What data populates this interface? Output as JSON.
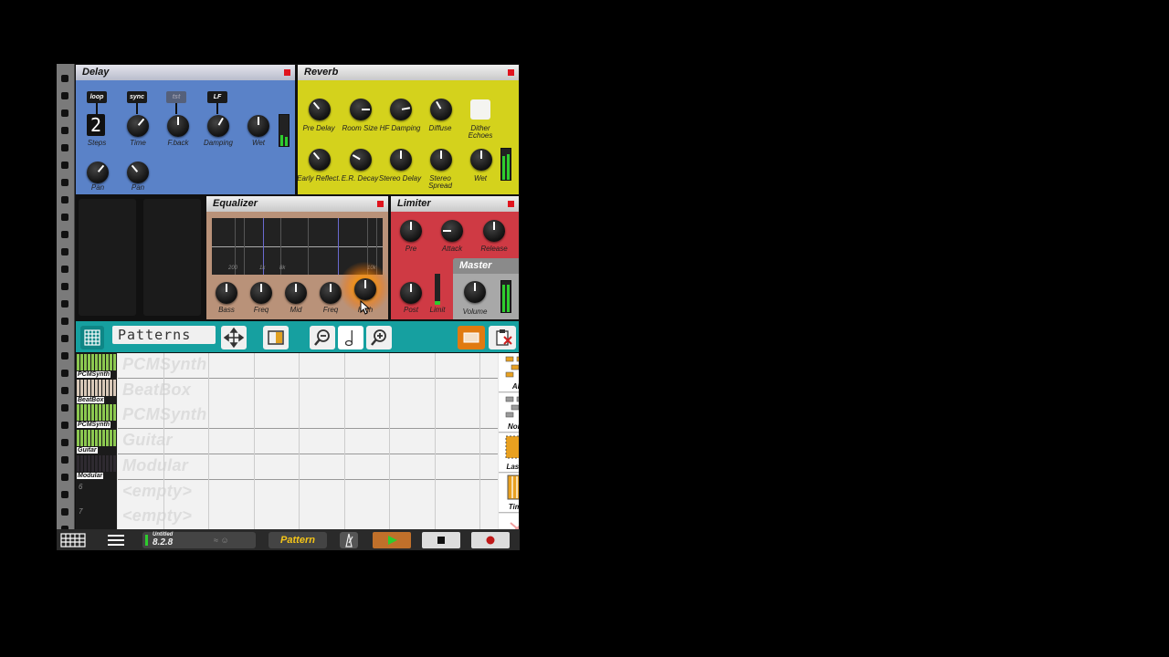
{
  "delay": {
    "title": "Delay",
    "toggles": [
      "loop",
      "sync",
      "tst",
      "LF"
    ],
    "steps_value": "2",
    "knobs": [
      "Steps",
      "Time",
      "F.back",
      "Damping",
      "Wet"
    ],
    "pan_knobs": [
      "Pan",
      "Pan"
    ]
  },
  "reverb": {
    "title": "Reverb",
    "row1": [
      "Pre Delay",
      "Room Size",
      "HF Damping",
      "Diffuse",
      "Dither Echoes"
    ],
    "row2": [
      "Early Reflect.",
      "E.R. Decay",
      "Stereo Delay",
      "Stereo Spread",
      "Wet"
    ]
  },
  "equalizer": {
    "title": "Equalizer",
    "freq_labels": [
      "200",
      "1k",
      "8k",
      "10k"
    ],
    "knobs": [
      "Bass",
      "Freq",
      "Mid",
      "Freq",
      "High"
    ]
  },
  "limiter": {
    "title": "Limiter",
    "knobs": [
      "Pre",
      "Attack",
      "Release",
      "Post",
      "Limit"
    ]
  },
  "master": {
    "title": "Master",
    "knobs": [
      "Volume"
    ]
  },
  "toolbar": {
    "mode_label": "Patterns"
  },
  "tracks": [
    {
      "name": "PCMSynth",
      "lane": "PCMSynth",
      "num": ""
    },
    {
      "name": "BeatBox",
      "lane": "BeatBox",
      "num": ""
    },
    {
      "name": "PCMSynth",
      "lane": "PCMSynth",
      "num": ""
    },
    {
      "name": "Guitar",
      "lane": "Guitar",
      "num": ""
    },
    {
      "name": "Modular",
      "lane": "Modular",
      "num": ""
    },
    {
      "name": "",
      "lane": "<empty>",
      "num": "6"
    },
    {
      "name": "",
      "lane": "<empty>",
      "num": "7"
    }
  ],
  "tools": [
    "All",
    "None",
    "Lasso",
    "Time"
  ],
  "status": {
    "song_name": "Untitled",
    "version": "8.2.8",
    "mode_button": "Pattern"
  },
  "colors": {
    "delay_bg": "#5a82c8",
    "reverb_bg": "#d4d21c",
    "equalizer_bg": "#b99279",
    "limiter_bg": "#cf3a44",
    "master_bg": "#a8a8a8",
    "toolbar_bg": "#16a0a0",
    "accent_orange": "#e07a10"
  }
}
